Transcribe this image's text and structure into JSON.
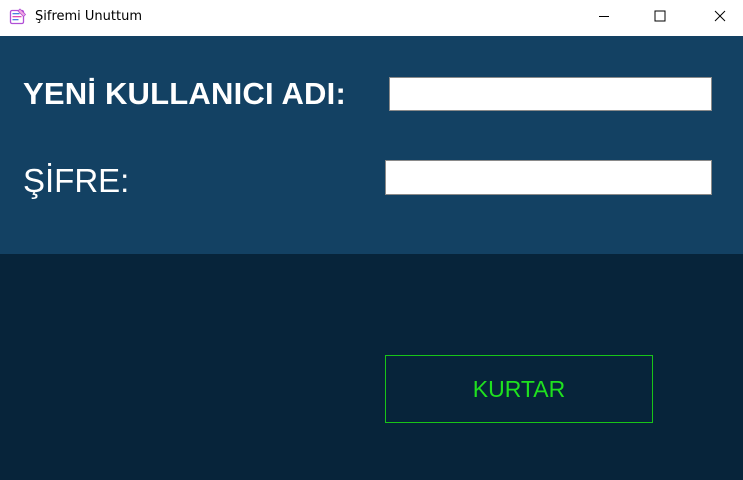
{
  "window": {
    "title": "Şifremi Unuttum",
    "app_icon": "form-app-icon",
    "controls": {
      "minimize_icon": "minimize-icon",
      "maximize_icon": "maximize-icon",
      "close_icon": "close-icon"
    }
  },
  "form": {
    "username_label": "YENİ KULLANICI ADI:",
    "username_value": "",
    "password_label": "ŞİFRE:",
    "password_value": "",
    "recover_button_label": "KURTAR"
  },
  "colors": {
    "top_panel": "#134163",
    "bottom_panel": "#07243a",
    "button_text": "#1fe01f",
    "button_border": "#18c418",
    "label_text": "#ffffff"
  }
}
